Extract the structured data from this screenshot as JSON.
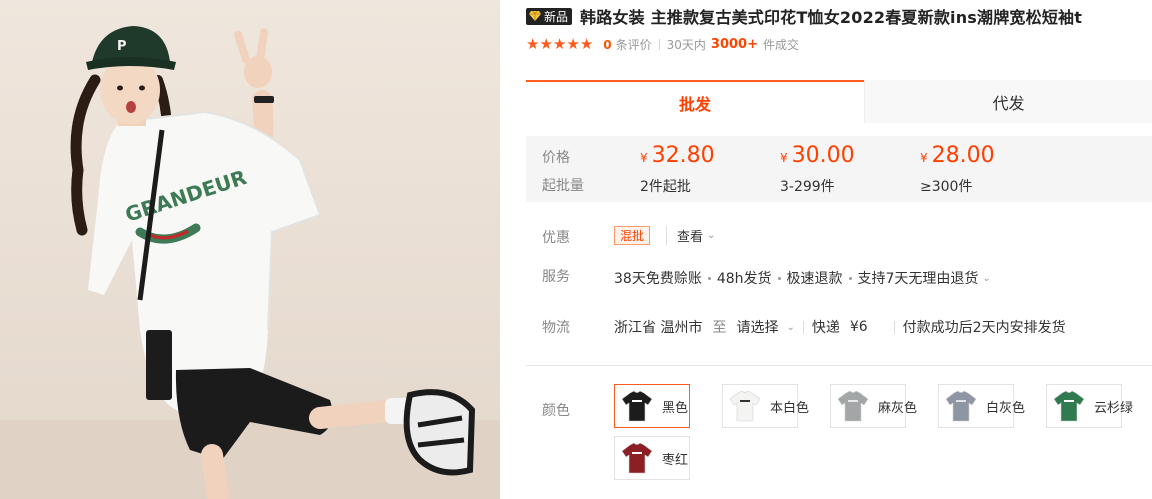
{
  "product": {
    "badge_label": "新品",
    "title": "韩路女装 主推款复古美式印花T恤女2022春夏新款ins潮牌宽松短袖t",
    "image_alt": "Model wearing white oversized T-shirt with GRANDEUR print, black cap and shorts"
  },
  "rating": {
    "stars": 5,
    "review_count": "0",
    "review_unit": "条评价",
    "period": "30天内",
    "sold_count": "3000+",
    "sold_unit": "件成交"
  },
  "tabs": [
    {
      "label": "批发",
      "active": true
    },
    {
      "label": "代发",
      "active": false
    }
  ],
  "pricing": {
    "price_label": "价格",
    "moq_label": "起批量",
    "currency": "¥",
    "tiers": [
      {
        "price": "32.80",
        "qty": "2件起批"
      },
      {
        "price": "30.00",
        "qty": "3-299件"
      },
      {
        "price": "28.00",
        "qty": "≥300件"
      }
    ]
  },
  "promo": {
    "label": "优惠",
    "tag": "混批",
    "view_label": "查看"
  },
  "service": {
    "label": "服务",
    "items": [
      "38天免费赊账",
      "48h发货",
      "极速退款",
      "支持7天无理由退货"
    ]
  },
  "logistics": {
    "label": "物流",
    "origin": "浙江省 温州市",
    "to": "至",
    "destination_placeholder": "请选择",
    "method": "快递",
    "fee": "¥6",
    "shipping_note": "付款成功后2天内安排发货"
  },
  "colors": {
    "label": "颜色",
    "options": [
      {
        "name": "黑色",
        "swatch": "#1c1c1c",
        "print": "#ffffff",
        "selected": true
      },
      {
        "name": "本白色",
        "swatch": "#f4f4f2",
        "print": "#333333",
        "selected": false
      },
      {
        "name": "麻灰色",
        "swatch": "#a3a6a6",
        "print": "#e8e8e8",
        "selected": false
      },
      {
        "name": "白灰色",
        "swatch": "#8e96a3",
        "print": "#dfe3e8",
        "selected": false
      },
      {
        "name": "云杉绿",
        "swatch": "#2f7a4e",
        "print": "#ffffff",
        "selected": false
      },
      {
        "name": "枣红",
        "swatch": "#8c1f24",
        "print": "#ffffff",
        "selected": false
      }
    ]
  },
  "theme": {
    "accent": "#ff4000",
    "star": "#ff5b1f",
    "print_green": "#3e7a55"
  }
}
